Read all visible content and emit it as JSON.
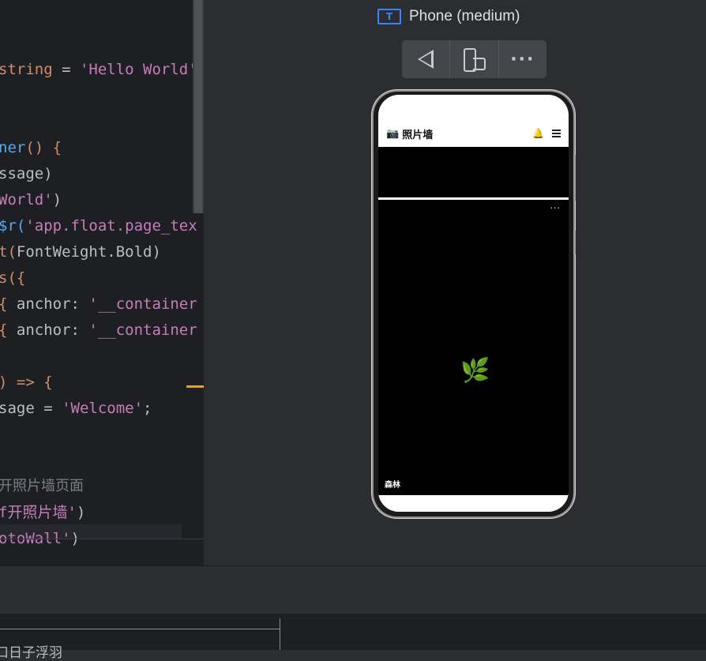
{
  "editor": {
    "lines": [
      {
        "a": "string",
        "b": " = ",
        "c": "'Hello World'"
      },
      {
        "a": "ner",
        "b": "() {"
      },
      {
        "a": "ssage)"
      },
      {
        "a": "World'",
        "b": ")"
      },
      {
        "a": "$r(",
        "b": "'app.float.page_tex"
      },
      {
        "a": "t(",
        "b": "FontWeight.Bold)"
      },
      {
        "a": "s({"
      },
      {
        "a": "{ ",
        "b": "anchor: ",
        "c": "'__container"
      },
      {
        "a": "{ ",
        "b": "anchor: ",
        "c": "'__container"
      },
      {
        "a": ") => {"
      },
      {
        "a": "sage = ",
        "b": "'Welcome'",
        "c": ";"
      },
      {
        "a": "开照片墙页面"
      },
      {
        "a": "f开照片墙'",
        "b": ")"
      },
      {
        "a": "otoWall'",
        "b": ")"
      }
    ]
  },
  "preview": {
    "device_name": "Phone (medium)",
    "device_icon_glyph": "T"
  },
  "phone": {
    "app_title": "照片墙",
    "photo_caption": "森林",
    "photo_more": "···"
  },
  "bottom": {
    "text": "口日子浮羽"
  }
}
